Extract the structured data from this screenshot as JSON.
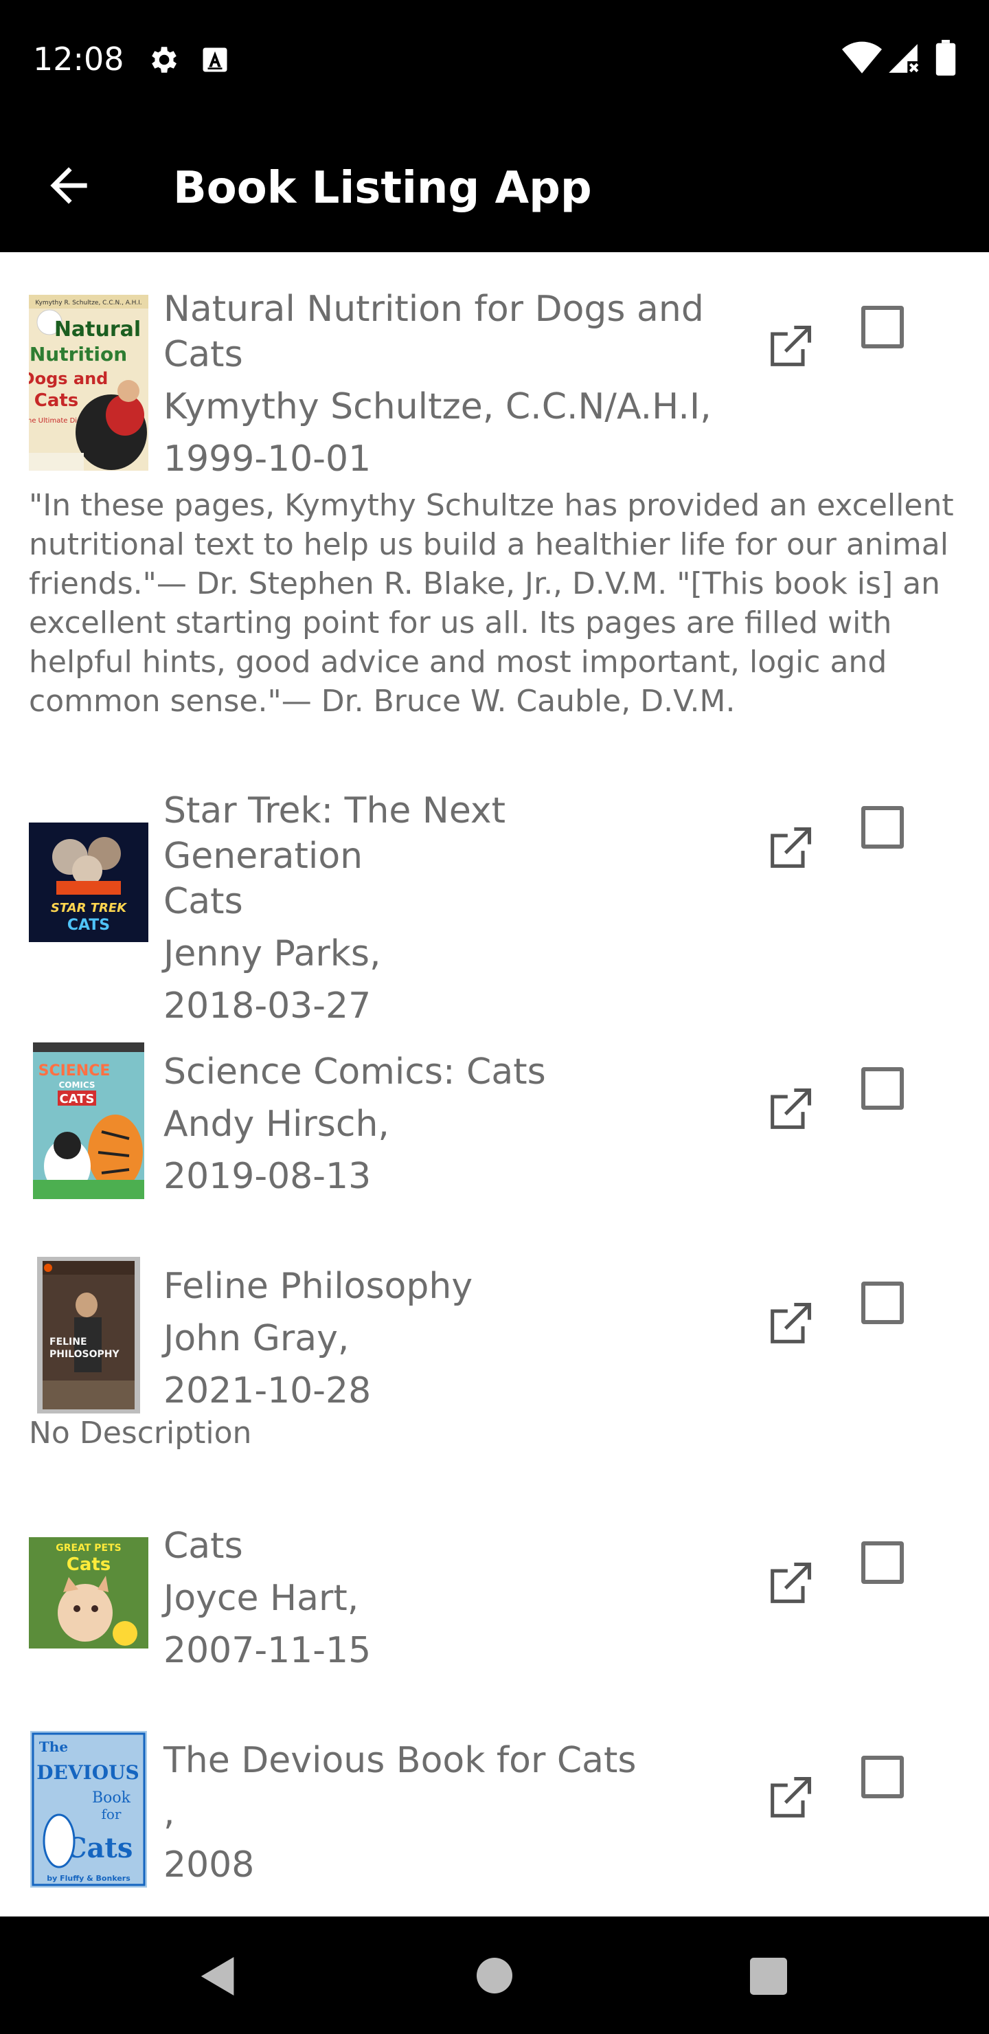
{
  "status": {
    "time": "12:08",
    "icons": [
      "gear-icon",
      "a-box-icon",
      "wifi-icon",
      "signal-icon",
      "battery-icon"
    ]
  },
  "appbar": {
    "title": "Book Listing App",
    "back_icon": "arrow-left-icon"
  },
  "books": [
    {
      "title": "Natural Nutrition for Dogs and Cats",
      "title_lines": [
        "Natural Nutrition for Dogs and",
        "Cats"
      ],
      "author": "Kymythy Schultze, C.C.N/A.H.I,",
      "date": "1999-10-01",
      "description": "\"In these pages, Kymythy Schultze has provided an excellent nutritional text to help us build a healthier life for our animal friends.\"— Dr. Stephen R. Blake, Jr., D.V.M. \"[This book is] an excellent starting point for us all. Its pages are filled with helpful hints, good advice and most important, logic and common sense.\"— Dr. Bruce W. Cauble, D.V.M.",
      "checked": false
    },
    {
      "title": "Star Trek: The Next Generation Cats",
      "title_lines": [
        "Star Trek: The Next Generation",
        "Cats"
      ],
      "author": "Jenny Parks,",
      "date": "2018-03-27",
      "description": "",
      "checked": false
    },
    {
      "title": "Science Comics: Cats",
      "title_lines": [
        "Science Comics: Cats"
      ],
      "author": "Andy Hirsch,",
      "date": "2019-08-13",
      "description": "",
      "checked": false
    },
    {
      "title": "Feline Philosophy",
      "title_lines": [
        "Feline Philosophy"
      ],
      "author": "John Gray,",
      "date": "2021-10-28",
      "description": "No Description",
      "checked": false
    },
    {
      "title": "Cats",
      "title_lines": [
        "Cats"
      ],
      "author": "Joyce Hart,",
      "date": "2007-11-15",
      "description": "",
      "checked": false
    },
    {
      "title": "The Devious Book for Cats",
      "title_lines": [
        "The Devious Book for Cats"
      ],
      "author": ",",
      "date": "2008",
      "description": "",
      "checked": false
    }
  ],
  "covers": {
    "cover1": {
      "line1": "Kymythy R. Schultze, C.C.N., A.H.I.",
      "line2": "Natural",
      "line3": "Nutrition",
      "line4": "Dogs and",
      "line5": "Cats",
      "line6": "The Ultimate Diet"
    },
    "cover2": {
      "line1": "STAR TREK",
      "line2": "CATS"
    },
    "cover3": {
      "line1": "SCIENCE",
      "line2": "COMICS",
      "line3": "CATS"
    },
    "cover4": {
      "line1": "FELINE",
      "line2": "PHILOSOPHY"
    },
    "cover5": {
      "line1": "GREAT PETS",
      "line2": "Cats"
    },
    "cover6": {
      "line1": "The",
      "line2": "DEVIOUS",
      "line3": "Book",
      "line4": "for",
      "line5": "Cats",
      "line6": "by Fluffy & Bonkers"
    }
  },
  "colors": {
    "bar_bg": "#000000",
    "text_secondary": "#6d6d6d",
    "checkbox_border": "#707070"
  },
  "navbar": {
    "icons": [
      "back-triangle-icon",
      "home-circle-icon",
      "recents-square-icon"
    ]
  }
}
